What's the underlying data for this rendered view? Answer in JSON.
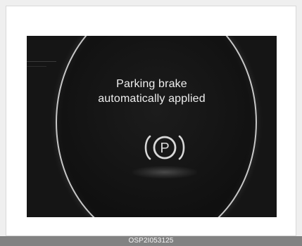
{
  "display": {
    "message_line_1": "Parking brake",
    "message_line_2": "automatically applied",
    "icon": "parking-brake-icon",
    "icon_letter": "P"
  },
  "caption": {
    "code": "OSP2I053125"
  },
  "colors": {
    "page_background": "#efefef",
    "screen_background": "#151515",
    "text": "#efefef",
    "caption_bar": "#828282",
    "gauge_ring": "#c8c8c8"
  }
}
